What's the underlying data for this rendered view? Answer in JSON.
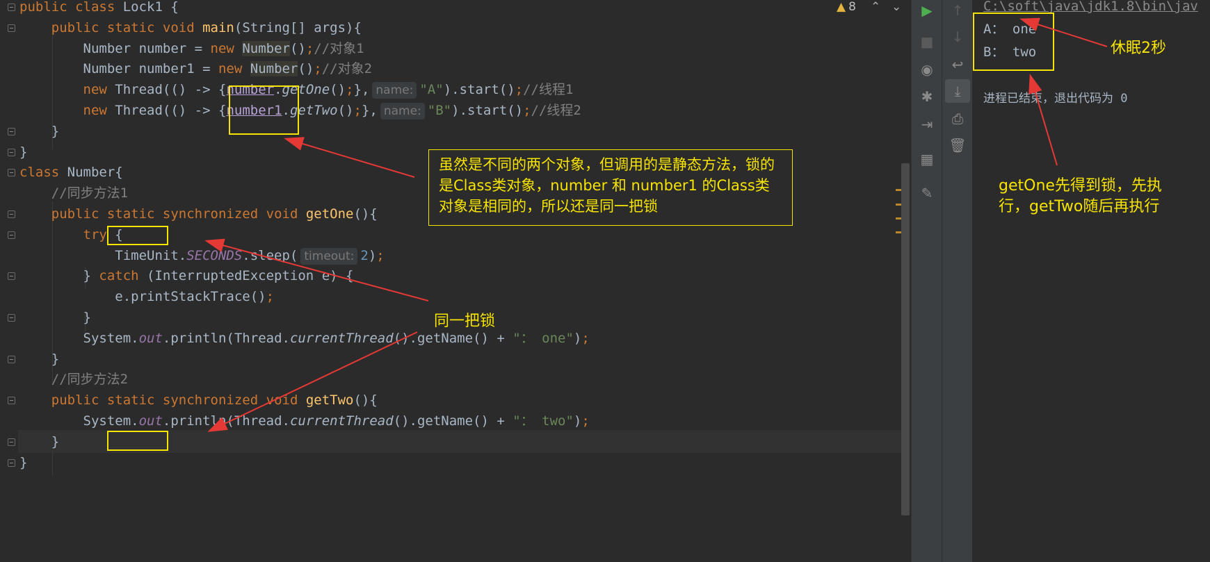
{
  "editor": {
    "warning_count": "8",
    "lines": [
      {
        "segments": [
          {
            "t": "public class ",
            "c": "kw"
          },
          {
            "t": "Lock1 {",
            "c": ""
          }
        ]
      },
      {
        "segments": [
          {
            "t": "    public static void ",
            "c": "kw"
          },
          {
            "t": "main",
            "c": "fn"
          },
          {
            "t": "(String[] args){",
            "c": ""
          }
        ]
      },
      {
        "segments": [
          {
            "t": "        Number number = ",
            "c": ""
          },
          {
            "t": "new ",
            "c": "kw"
          },
          {
            "t": "Number",
            "c": "hl"
          },
          {
            "t": "()",
            "c": ""
          },
          {
            "t": ";",
            "c": "kw"
          },
          {
            "t": "//对象1",
            "c": "cm"
          }
        ]
      },
      {
        "segments": [
          {
            "t": "        Number number1 = ",
            "c": ""
          },
          {
            "t": "new ",
            "c": "kw"
          },
          {
            "t": "Number",
            "c": "hl"
          },
          {
            "t": "()",
            "c": ""
          },
          {
            "t": ";",
            "c": "kw"
          },
          {
            "t": "//对象2",
            "c": "cm"
          }
        ]
      },
      {
        "segments": [
          {
            "t": "        ",
            "c": ""
          },
          {
            "t": "new ",
            "c": "kw"
          },
          {
            "t": "Thread(() -> {",
            "c": ""
          },
          {
            "t": "number",
            "c": "ul"
          },
          {
            "t": ".",
            "c": ""
          },
          {
            "t": "getOne",
            "c": "it"
          },
          {
            "t": "()",
            "c": ""
          },
          {
            "t": ";",
            "c": "kw"
          },
          {
            "t": "},",
            "c": ""
          },
          {
            "hint": "name:"
          },
          {
            "t": "\"A\"",
            "c": "str"
          },
          {
            "t": ").start()",
            "c": ""
          },
          {
            "t": ";",
            "c": "kw"
          },
          {
            "t": "//线程1",
            "c": "cm"
          }
        ]
      },
      {
        "segments": [
          {
            "t": "        ",
            "c": ""
          },
          {
            "t": "new ",
            "c": "kw"
          },
          {
            "t": "Thread(() -> {",
            "c": ""
          },
          {
            "t": "number1",
            "c": "ul"
          },
          {
            "t": ".",
            "c": ""
          },
          {
            "t": "getTwo",
            "c": "it"
          },
          {
            "t": "()",
            "c": ""
          },
          {
            "t": ";",
            "c": "kw"
          },
          {
            "t": "},",
            "c": ""
          },
          {
            "hint": "name:"
          },
          {
            "t": "\"B\"",
            "c": "str"
          },
          {
            "t": ").start()",
            "c": ""
          },
          {
            "t": ";",
            "c": "kw"
          },
          {
            "t": "//线程2",
            "c": "cm"
          }
        ]
      },
      {
        "segments": [
          {
            "t": "    }",
            "c": ""
          }
        ]
      },
      {
        "segments": [
          {
            "t": "}",
            "c": ""
          }
        ]
      },
      {
        "segments": [
          {
            "t": "class ",
            "c": "kw"
          },
          {
            "t": "Number{",
            "c": ""
          }
        ]
      },
      {
        "segments": [
          {
            "t": "    //同步方法1",
            "c": "cm"
          }
        ]
      },
      {
        "segments": [
          {
            "t": "    public ",
            "c": "kw"
          },
          {
            "t": "static ",
            "c": "kw"
          },
          {
            "t": "synchronized void ",
            "c": "kw"
          },
          {
            "t": "getOne",
            "c": "fn"
          },
          {
            "t": "(){",
            "c": ""
          }
        ]
      },
      {
        "segments": [
          {
            "t": "        try ",
            "c": "kw"
          },
          {
            "t": "{",
            "c": ""
          }
        ]
      },
      {
        "segments": [
          {
            "t": "            TimeUnit.",
            "c": ""
          },
          {
            "t": "SECONDS",
            "c": "st"
          },
          {
            "t": ".sleep(",
            "c": ""
          },
          {
            "hint": "timeout:"
          },
          {
            "t": "2",
            "c": "num"
          },
          {
            "t": ")",
            "c": ""
          },
          {
            "t": ";",
            "c": "kw"
          }
        ]
      },
      {
        "segments": [
          {
            "t": "        } ",
            "c": ""
          },
          {
            "t": "catch ",
            "c": "kw"
          },
          {
            "t": "(InterruptedException e) {",
            "c": ""
          }
        ]
      },
      {
        "segments": [
          {
            "t": "            e.printStackTrace()",
            "c": ""
          },
          {
            "t": ";",
            "c": "kw"
          }
        ]
      },
      {
        "segments": [
          {
            "t": "        }",
            "c": ""
          }
        ]
      },
      {
        "segments": [
          {
            "t": "        System.",
            "c": ""
          },
          {
            "t": "out",
            "c": "st"
          },
          {
            "t": ".println(Thread.",
            "c": ""
          },
          {
            "t": "currentThread",
            "c": "it"
          },
          {
            "t": "().getName() + ",
            "c": ""
          },
          {
            "t": "\"： one\"",
            "c": "str"
          },
          {
            "t": ")",
            "c": ""
          },
          {
            "t": ";",
            "c": "kw"
          }
        ]
      },
      {
        "segments": [
          {
            "t": "    }",
            "c": ""
          }
        ]
      },
      {
        "segments": [
          {
            "t": "    //同步方法2",
            "c": "cm"
          }
        ]
      },
      {
        "segments": [
          {
            "t": "    public ",
            "c": "kw"
          },
          {
            "t": "static ",
            "c": "kw"
          },
          {
            "t": "synchronized void ",
            "c": "kw"
          },
          {
            "t": "getTwo",
            "c": "fn"
          },
          {
            "t": "(){",
            "c": ""
          }
        ]
      },
      {
        "segments": [
          {
            "t": "        System.",
            "c": ""
          },
          {
            "t": "out",
            "c": "st"
          },
          {
            "t": ".println(Thread.",
            "c": ""
          },
          {
            "t": "currentThread",
            "c": "it"
          },
          {
            "t": "().getName() + ",
            "c": ""
          },
          {
            "t": "\"： two\"",
            "c": "str"
          },
          {
            "t": ")",
            "c": ""
          },
          {
            "t": ";",
            "c": "kw"
          }
        ]
      },
      {
        "segments": [
          {
            "t": "    }",
            "c": ""
          }
        ]
      },
      {
        "segments": [
          {
            "t": "}",
            "c": ""
          }
        ]
      }
    ]
  },
  "console": {
    "path": "C:\\soft\\java\\jdk1.8\\bin\\jav",
    "output_a": "A： one",
    "output_b": "B： two",
    "exit_message": "进程已结束，退出代码为 0"
  },
  "annotations": {
    "box_note": "虽然是不同的两个对象，但调用的是静态方法，锁的是Class类对象，number 和 number1 的Class类对象是相同的，所以还是同一把锁",
    "same_lock": "同一把锁",
    "sleep_note": "休眠2秒",
    "order_note": "getOne先得到锁，先执行，getTwo随后再执行"
  },
  "colors": {
    "annotation": "#f7e400",
    "arrow": "#e53935",
    "keyword": "#cc7832",
    "function": "#ffc66d",
    "string": "#6a8759",
    "comment": "#808080",
    "run_icon": "#4caf50"
  }
}
